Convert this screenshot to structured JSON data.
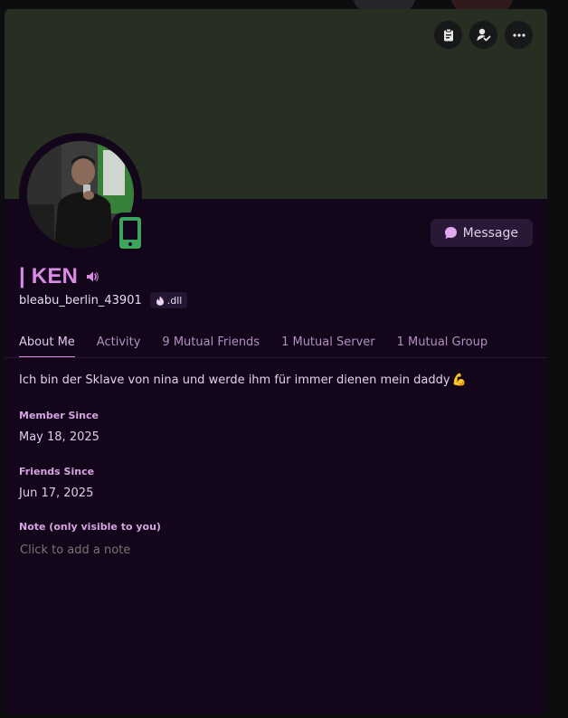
{
  "profile": {
    "display_name": "| KEN",
    "username": "bleabu_berlin_43901",
    "tag": ".dll",
    "bio": "Ich bin der Sklave von nina und werde ihm für immer dienen mein daddy",
    "bio_emoji": "💪",
    "status": "mobile-online"
  },
  "actions": {
    "message_label": "Message"
  },
  "tabs": [
    {
      "label": "About Me",
      "active": true
    },
    {
      "label": "Activity",
      "active": false
    },
    {
      "label": "9 Mutual Friends",
      "active": false
    },
    {
      "label": "1 Mutual Server",
      "active": false
    },
    {
      "label": "1 Mutual Group",
      "active": false
    }
  ],
  "about": {
    "member_since_label": "Member Since",
    "member_since": "May 18, 2025",
    "friends_since_label": "Friends Since",
    "friends_since": "Jun 17, 2025",
    "note_label": "Note (only visible to you)",
    "note_placeholder": "Click to add a note"
  },
  "colors": {
    "banner": "#262f21",
    "card_bg": "#13061a",
    "accent": "#d98be6",
    "status_online": "#3ba55c"
  },
  "icons": [
    "clipboard-icon",
    "friend-check-icon",
    "more-icon",
    "speaker-icon",
    "mobile-phone-icon",
    "chat-bubble-icon",
    "fire-icon"
  ]
}
